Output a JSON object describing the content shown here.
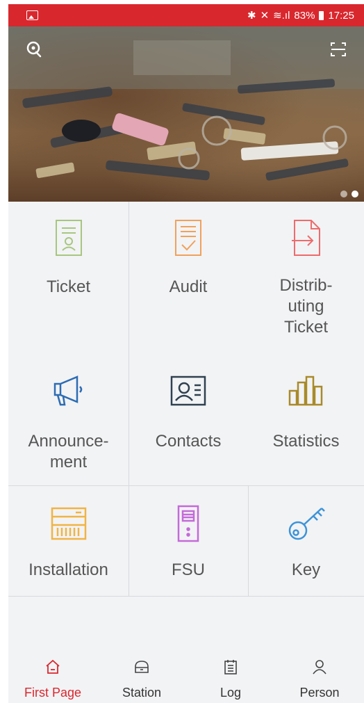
{
  "status_bar": {
    "battery": "83%",
    "time": "17:25"
  },
  "banner": {
    "search_icon": "search-key-icon",
    "scan_icon": "scan-icon",
    "page_count": 2,
    "active_page": 2
  },
  "grid": {
    "items": [
      {
        "label": "Ticket",
        "icon": "ticket-icon",
        "color": "#a7c67f"
      },
      {
        "label": "Audit",
        "icon": "audit-icon",
        "color": "#f0a15c"
      },
      {
        "label": "Distrib-\nuting\nTicket",
        "icon": "distributing-ticket-icon",
        "color": "#ee6b6b"
      },
      {
        "label": "Announce-\nment",
        "icon": "announcement-icon",
        "color": "#2d6cb3"
      },
      {
        "label": "Contacts",
        "icon": "contacts-icon",
        "color": "#2f4050"
      },
      {
        "label": "Statistics",
        "icon": "statistics-icon",
        "color": "#a98a2a"
      },
      {
        "label": "Installation",
        "icon": "installation-icon",
        "color": "#f0b445"
      },
      {
        "label": "FSU",
        "icon": "fsu-icon",
        "color": "#c46ad8"
      },
      {
        "label": "Key",
        "icon": "key-icon",
        "color": "#3d93d8"
      }
    ]
  },
  "bottom_nav": {
    "items": [
      {
        "label": "First Page",
        "icon": "home-icon",
        "active": true
      },
      {
        "label": "Station",
        "icon": "station-icon",
        "active": false
      },
      {
        "label": "Log",
        "icon": "log-icon",
        "active": false
      },
      {
        "label": "Person",
        "icon": "person-icon",
        "active": false
      }
    ]
  },
  "colors": {
    "accent": "#d9272e",
    "background": "#f2f3f5",
    "label": "#555555"
  }
}
